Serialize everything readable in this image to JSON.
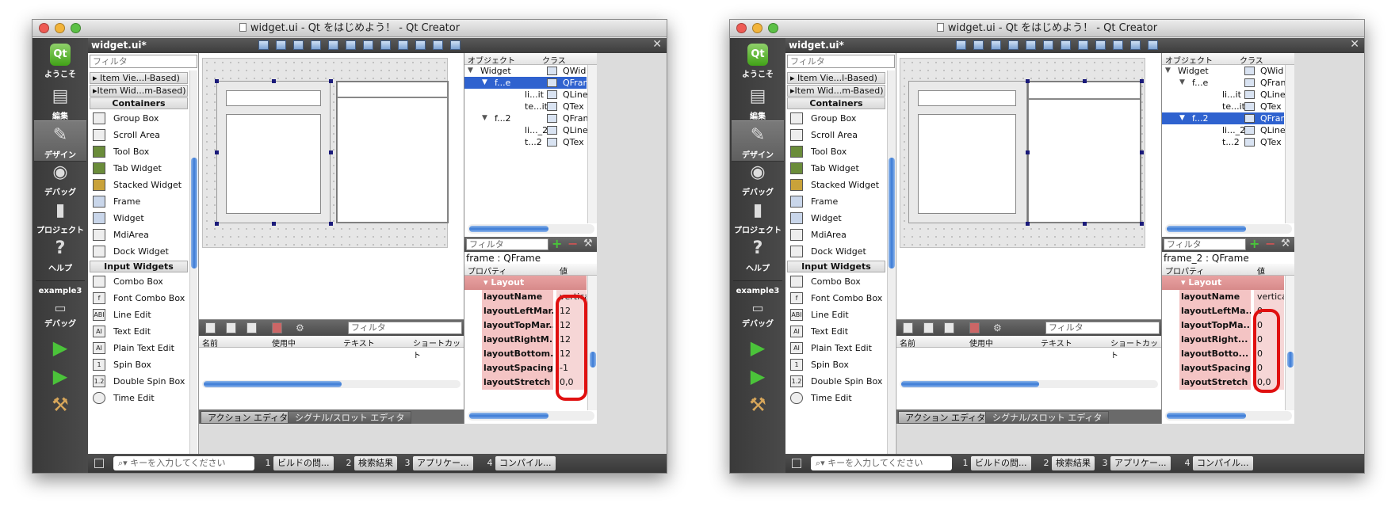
{
  "windows": [
    {
      "title": "widget.ui - Qt をはじめよう！ - Qt Creator",
      "filename": "widget.ui*",
      "modes": [
        {
          "label": "ようこそ",
          "icon": "qt-logo-icon"
        },
        {
          "label": "編集",
          "icon": "document-icon"
        },
        {
          "label": "デザイン",
          "icon": "brush-icon"
        },
        {
          "label": "デバッグ",
          "icon": "bug-icon"
        },
        {
          "label": "プロジェクト",
          "icon": "wrench-icon"
        },
        {
          "label": "ヘルプ",
          "icon": "help-icon"
        }
      ],
      "project_label": "example3",
      "project_mode": "デバッグ",
      "widget_filter_placeholder": "フィルタ",
      "widget_categories": [
        "Item Vie...l-Based)",
        "Item Wid...m-Based)",
        "Containers",
        "Input Widgets"
      ],
      "widgets": [
        "Group Box",
        "Scroll Area",
        "Tool Box",
        "Tab Widget",
        "Stacked Widget",
        "Frame",
        "Widget",
        "MdiArea",
        "Dock Widget",
        "Combo Box",
        "Font Combo Box",
        "Line Edit",
        "Text Edit",
        "Plain Text Edit",
        "Spin Box",
        "Double Spin Box",
        "Time Edit"
      ],
      "widget_icon_glyphs": [
        "",
        "",
        "",
        "",
        "",
        "",
        "",
        "",
        "",
        "",
        "f",
        "ABI",
        "AI",
        "AI",
        "1",
        "1.2",
        ""
      ],
      "action_filter_placeholder": "フィルタ",
      "action_columns": [
        "名前",
        "使用中",
        "テキスト",
        "ショートカット"
      ],
      "bottom_tabs": [
        "アクション エディタ",
        "シグナル/スロット エディタ"
      ],
      "obj_columns": [
        "オブジェクト",
        "クラス"
      ],
      "objects": [
        {
          "name": "Widget",
          "class": "QWid",
          "level": 0
        },
        {
          "name": "f...e",
          "class": "QFran",
          "level": 1
        },
        {
          "name": "li...it",
          "class": "QLine",
          "level": 2
        },
        {
          "name": "te...it",
          "class": "QTex",
          "level": 2
        },
        {
          "name": "f...2",
          "class": "QFran",
          "level": 1
        },
        {
          "name": "li..._2",
          "class": "QLine",
          "level": 2
        },
        {
          "name": "t...2",
          "class": "QTex",
          "level": 2
        }
      ],
      "selected_object": 1,
      "prop_filter_placeholder": "フィルタ",
      "prop_object_name": "frame : QFrame",
      "prop_columns": [
        "プロパティ",
        "値"
      ],
      "prop_group": "Layout",
      "properties": [
        {
          "name": "layoutName",
          "value": "vertica"
        },
        {
          "name": "layoutLeftMar...",
          "value": "12"
        },
        {
          "name": "layoutTopMar...",
          "value": "12"
        },
        {
          "name": "layoutRightM...",
          "value": "12"
        },
        {
          "name": "layoutBottom...",
          "value": "12"
        },
        {
          "name": "layoutSpacing",
          "value": "-1"
        },
        {
          "name": "layoutStretch",
          "value": "0,0"
        }
      ],
      "search_placeholder": "キーを入力してください",
      "status_buttons": [
        {
          "num": "1",
          "label": "ビルドの問..."
        },
        {
          "num": "2",
          "label": "検索結果"
        },
        {
          "num": "3",
          "label": "アプリケー..."
        },
        {
          "num": "4",
          "label": "コンパイル..."
        }
      ]
    },
    {
      "title": "widget.ui - Qt をはじめよう！ - Qt Creator",
      "filename": "widget.ui*",
      "modes": [
        {
          "label": "ようこそ",
          "icon": "qt-logo-icon"
        },
        {
          "label": "編集",
          "icon": "document-icon"
        },
        {
          "label": "デザイン",
          "icon": "brush-icon"
        },
        {
          "label": "デバッグ",
          "icon": "bug-icon"
        },
        {
          "label": "プロジェクト",
          "icon": "wrench-icon"
        },
        {
          "label": "ヘルプ",
          "icon": "help-icon"
        }
      ],
      "project_label": "example3",
      "project_mode": "デバッグ",
      "widget_filter_placeholder": "フィルタ",
      "widget_categories": [
        "Item Vie...l-Based)",
        "Item Wid...m-Based)",
        "Containers",
        "Input Widgets"
      ],
      "widgets": [
        "Group Box",
        "Scroll Area",
        "Tool Box",
        "Tab Widget",
        "Stacked Widget",
        "Frame",
        "Widget",
        "MdiArea",
        "Dock Widget",
        "Combo Box",
        "Font Combo Box",
        "Line Edit",
        "Text Edit",
        "Plain Text Edit",
        "Spin Box",
        "Double Spin Box",
        "Time Edit"
      ],
      "widget_icon_glyphs": [
        "",
        "",
        "",
        "",
        "",
        "",
        "",
        "",
        "",
        "",
        "f",
        "ABI",
        "AI",
        "AI",
        "1",
        "1.2",
        ""
      ],
      "action_filter_placeholder": "フィルタ",
      "action_columns": [
        "名前",
        "使用中",
        "テキスト",
        "ショートカット"
      ],
      "bottom_tabs": [
        "アクション エディタ",
        "シグナル/スロット エディタ"
      ],
      "obj_columns": [
        "オブジェクト",
        "クラス"
      ],
      "objects": [
        {
          "name": "Widget",
          "class": "QWid",
          "level": 0
        },
        {
          "name": "f...e",
          "class": "QFran",
          "level": 1
        },
        {
          "name": "li...it",
          "class": "QLine",
          "level": 2
        },
        {
          "name": "te...it",
          "class": "QTex",
          "level": 2
        },
        {
          "name": "f...2",
          "class": "QFran",
          "level": 1
        },
        {
          "name": "li..._2",
          "class": "QLine",
          "level": 2
        },
        {
          "name": "t...2",
          "class": "QTex",
          "level": 2
        }
      ],
      "selected_object": 4,
      "prop_filter_placeholder": "フィルタ",
      "prop_object_name": "frame_2 : QFrame",
      "prop_columns": [
        "プロパティ",
        "値"
      ],
      "prop_group": "Layout",
      "properties": [
        {
          "name": "layoutName",
          "value": "vertica"
        },
        {
          "name": "layoutLeftMa...",
          "value": "0"
        },
        {
          "name": "layoutTopMa...",
          "value": "0"
        },
        {
          "name": "layoutRight...",
          "value": "0"
        },
        {
          "name": "layoutBotto...",
          "value": "0"
        },
        {
          "name": "layoutSpacing",
          "value": "0"
        },
        {
          "name": "layoutStretch",
          "value": "0,0"
        }
      ],
      "search_placeholder": "キーを入力してください",
      "status_buttons": [
        {
          "num": "1",
          "label": "ビルドの問..."
        },
        {
          "num": "2",
          "label": "検索結果"
        },
        {
          "num": "3",
          "label": "アプリケー..."
        },
        {
          "num": "4",
          "label": "コンパイル..."
        }
      ]
    }
  ],
  "colors": {
    "selection": "#2f62cf",
    "highlight_ring": "#e01010",
    "property_row": "#f4c4c4",
    "run_green": "#4bc33a"
  }
}
